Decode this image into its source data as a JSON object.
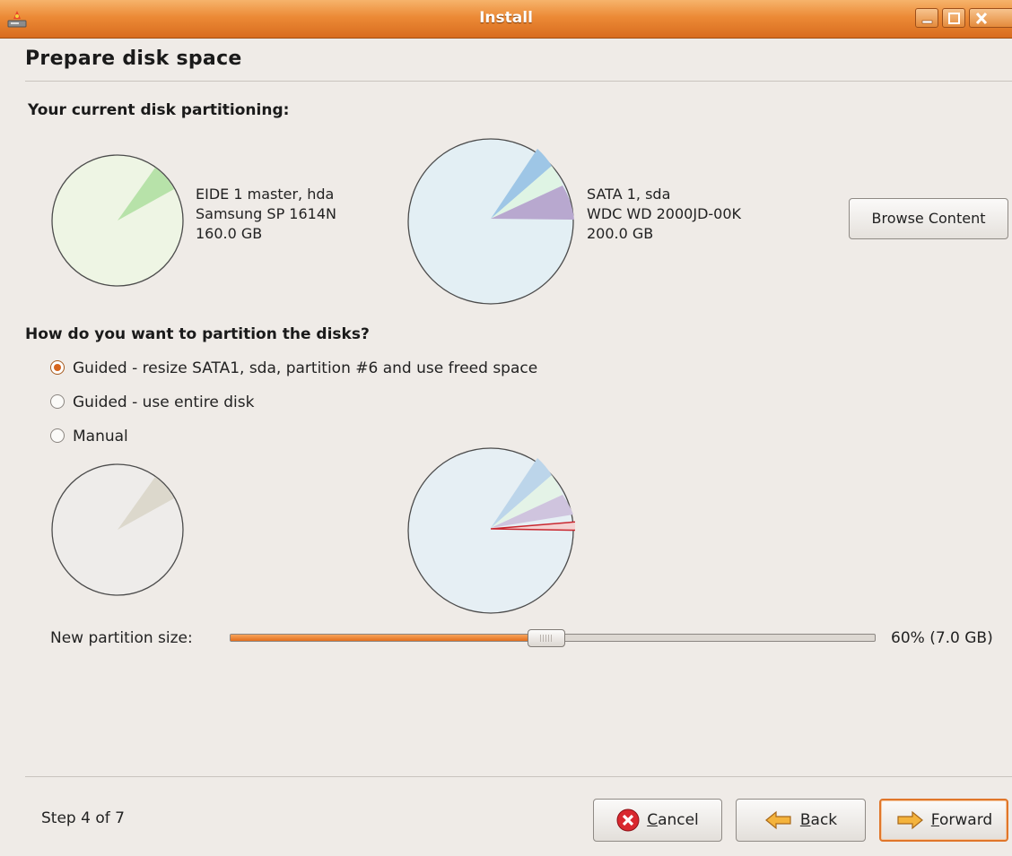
{
  "window": {
    "title": "Install"
  },
  "page": {
    "title": "Prepare disk space",
    "current_partitioning_heading": "Your current disk partitioning:",
    "partition_question": "How do you want to partition the disks?"
  },
  "disks": [
    {
      "line1": "EIDE 1 master, hda",
      "line2": "Samsung SP 1614N",
      "line3": "160.0 GB"
    },
    {
      "line1": "SATA 1, sda",
      "line2": "WDC WD 2000JD-00K",
      "line3": "200.0 GB"
    }
  ],
  "browse_button": {
    "label": "Browse Content"
  },
  "options": [
    {
      "label": "Guided - resize SATA1, sda, partition #6 and use freed space",
      "selected": true
    },
    {
      "label": "Guided - use entire disk",
      "selected": false
    },
    {
      "label": "Manual",
      "selected": false
    }
  ],
  "slider": {
    "label": "New partition size:",
    "value_text": "60% (7.0 GB)",
    "fraction": 0.49
  },
  "footer": {
    "step": "Step 4 of 7",
    "cancel": {
      "mnemonic": "C",
      "rest": "ancel"
    },
    "back": {
      "mnemonic": "B",
      "rest": "ack"
    },
    "forward": {
      "mnemonic": "F",
      "rest": "orward"
    }
  },
  "colors": {
    "titlebar": "#ec8a36",
    "accent": "#e36f1e",
    "background": "#efebe7"
  }
}
